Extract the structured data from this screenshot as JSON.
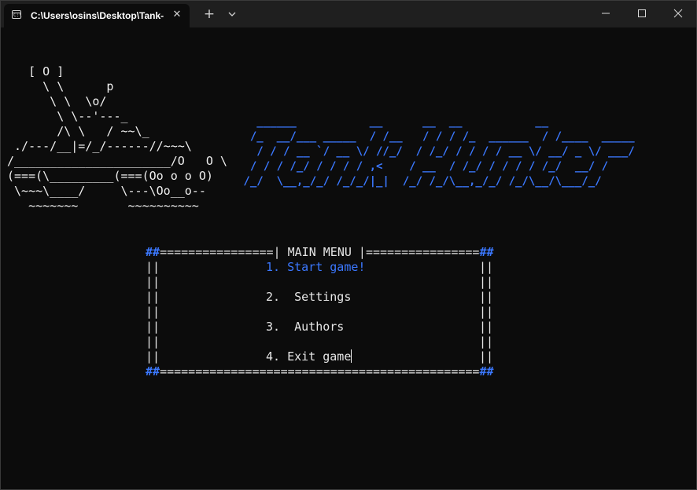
{
  "window": {
    "tab_title": "C:\\Users\\osins\\Desktop\\Tank-",
    "tab_icon_text": "C:\\"
  },
  "colors": {
    "background": "#0c0c0c",
    "titlebar": "#1f1f1f",
    "text": "#e6e6e6",
    "accent": "#3b78ff"
  },
  "icons": {
    "tab": "terminal-icon",
    "close_tab": "close-icon",
    "new_tab": "plus-icon",
    "dropdown": "chevron-down-icon",
    "minimize": "minimize-icon",
    "maximize": "maximize-icon",
    "close_window": "close-icon"
  },
  "tank_art": "   [ O ]\n     \\ \\      p\n      \\ \\  \\o/\n       \\ \\--'---_\n       /\\ \\   / ~~\\_\n ./---/__|=/_/------//~~~\\\n/______________________/O   O \\\n(===(\\_________(===(Oo o o O)\n \\~~~\\____/     \\---\\Oo__o--\n   ~~~~~~~       ~~~~~~~~~~",
  "title_art": "   ______           __      __  __           __\n  /_  __/___ _____  / /__   / / / /_  ______  / /____  _____\n   / / / __ `/ __ \\/ //_/  / /_/ / / / / __ \\/ __/ _ \\/ ___/\n  / / / /_/ / / / / ,<    / __  / /_/ / / / / /_/  __/ /\n /_/  \\__,_/_/ /_/_/|_|  /_/ /_/\\__,_/_/ /_/\\__/\\___/_/",
  "menu": {
    "top_left": "##",
    "top_middle": "================| MAIN MENU |================",
    "top_right": "##",
    "side": "||",
    "bottom_left": "##",
    "bottom_middle": "=============================================",
    "bottom_right": "##",
    "items": [
      {
        "label": "1. Start game!"
      },
      {
        "label": "2.  Settings"
      },
      {
        "label": "3.  Authors"
      },
      {
        "label": "4. Exit game"
      }
    ],
    "selected_index": 0
  }
}
